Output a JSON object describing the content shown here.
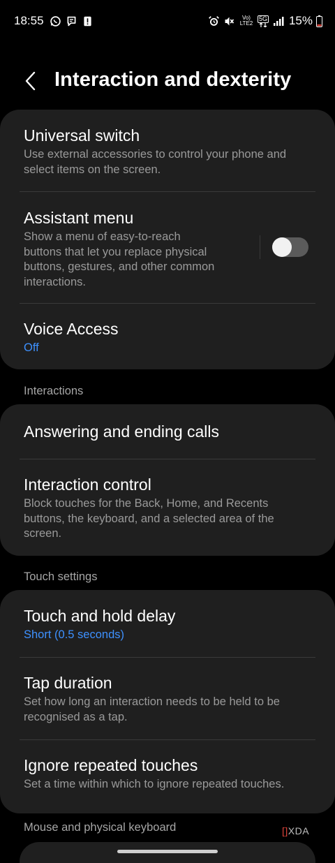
{
  "status_bar": {
    "time": "18:55",
    "network_volte": "Vo)",
    "network_lte": "LTE2",
    "network_5g": "5G",
    "battery": "15%",
    "icons_left": [
      "whatsapp-icon",
      "messages-icon",
      "alert-icon"
    ],
    "icons_right": [
      "alarm-icon",
      "mute-icon",
      "volte-icon",
      "5g-icon",
      "signal-icon",
      "battery-icon"
    ]
  },
  "header": {
    "title": "Interaction and dexterity"
  },
  "card1": {
    "universal_switch": {
      "title": "Universal switch",
      "subtitle_line1": "Use external accessories to control your phone and",
      "subtitle_line2": "select items on the screen."
    },
    "assistant_menu": {
      "title": "Assistant menu",
      "subtitle_line1": "Show a menu of easy-to-reach",
      "subtitle_line2": "buttons that let you replace physical",
      "subtitle_line3": "buttons, gestures, and other common",
      "subtitle_line4": "interactions.",
      "toggle_on": false
    },
    "voice_access": {
      "title": "Voice Access",
      "value": "Off"
    }
  },
  "sections": {
    "interactions": "Interactions",
    "touch_settings": "Touch settings",
    "mouse_keyboard": "Mouse and physical keyboard"
  },
  "card2": {
    "answering_calls": {
      "title": "Answering and ending calls"
    },
    "interaction_control": {
      "title": "Interaction control",
      "subtitle_line1": "Block touches for the Back, Home, and Recents",
      "subtitle_line2": "buttons, the keyboard, and a selected area of the",
      "subtitle_line3": "screen."
    }
  },
  "card3": {
    "touch_hold_delay": {
      "title": "Touch and hold delay",
      "value": "Short (0.5 seconds)"
    },
    "tap_duration": {
      "title": "Tap duration",
      "subtitle_line1": "Set how long an interaction needs to be held to be",
      "subtitle_line2": "recognised as a tap."
    },
    "ignore_repeated": {
      "title": "Ignore repeated touches",
      "subtitle_line1": "Set a time within which to ignore repeated touches."
    }
  },
  "watermark": {
    "bracket": "[]",
    "text": "XDA"
  },
  "colors": {
    "background": "#000000",
    "card": "#1f1f1f",
    "accent_blue": "#3e91ff",
    "subtitle_gray": "#9a9a9a",
    "divider": "#3a3a3a"
  }
}
